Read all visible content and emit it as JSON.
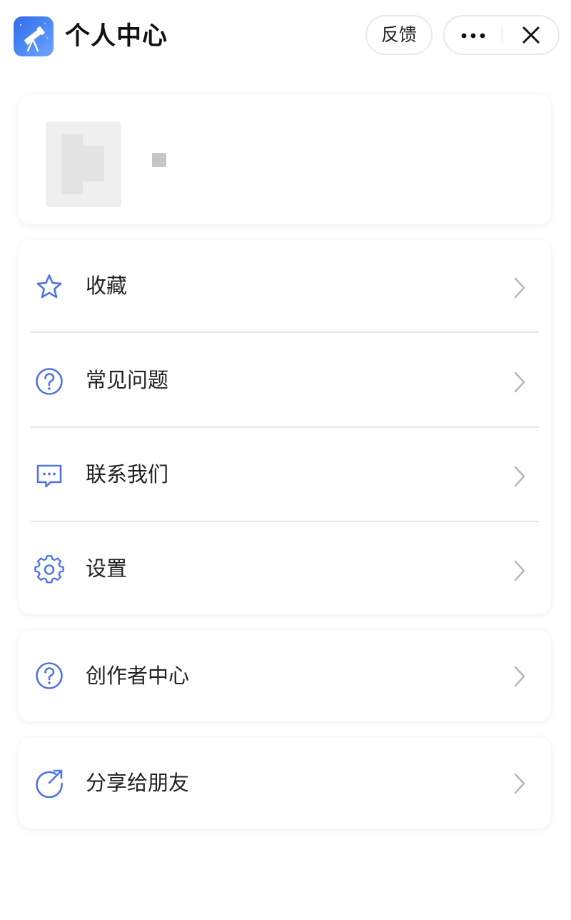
{
  "header": {
    "title": "个人中心",
    "feedback_label": "反馈",
    "more_icon": "more-dots-icon",
    "close_icon": "close-icon",
    "logo_icon": "telescope-logo-icon"
  },
  "menu": [
    {
      "label": "收藏",
      "icon": "star-icon"
    },
    {
      "label": "常见问题",
      "icon": "question-circle-icon"
    },
    {
      "label": "联系我们",
      "icon": "message-dots-icon"
    },
    {
      "label": "设置",
      "icon": "gear-icon"
    }
  ],
  "creator": {
    "label": "创作者中心",
    "icon": "question-circle-icon"
  },
  "share": {
    "label": "分享给朋友",
    "icon": "share-arrow-icon"
  },
  "colors": {
    "accent": "#4f74e6",
    "chevron": "#b8b8bc",
    "separator": "#e6e6ea"
  }
}
